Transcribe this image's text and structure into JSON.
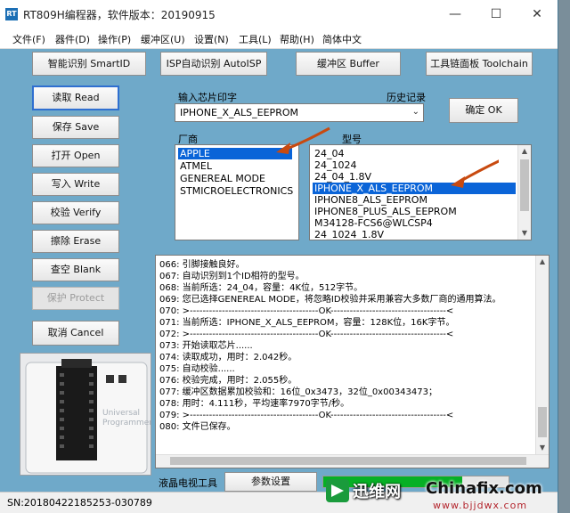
{
  "window": {
    "title": "RT809H编程器，软件版本：20190915"
  },
  "menu": [
    {
      "label": "文件(F)"
    },
    {
      "label": "器件(D)"
    },
    {
      "label": "操作(P)"
    },
    {
      "label": "缓冲区(U)"
    },
    {
      "label": "设置(N)"
    },
    {
      "label": "工具(L)"
    },
    {
      "label": "帮助(H)"
    },
    {
      "label": "简体中文"
    }
  ],
  "toolbar": {
    "smart_id": "智能识别 SmartID",
    "isp_auto": "ISP自动识别 AutoISP",
    "buffer": "缓冲区 Buffer",
    "toolchain": "工具链面板 Toolchain"
  },
  "actions": {
    "read": "读取 Read",
    "save": "保存 Save",
    "open": "打开 Open",
    "write": "写入 Write",
    "verify": "校验 Verify",
    "erase": "擦除 Erase",
    "blank": "查空 Blank",
    "protect": "保护 Protect",
    "cancel": "取消 Cancel"
  },
  "chip_input": {
    "label": "输入芯片印字",
    "history_label": "历史记录",
    "value": "IPHONE_X_ALS_EEPROM",
    "confirm": "确定 OK"
  },
  "vendor": {
    "label": "厂商",
    "items": [
      {
        "label": "APPLE",
        "selected": true
      },
      {
        "label": "ATMEL",
        "selected": false
      },
      {
        "label": "GENEREAL MODE",
        "selected": false
      },
      {
        "label": "STMICROELECTRONICS",
        "selected": false
      }
    ]
  },
  "model": {
    "label": "型号",
    "items": [
      {
        "label": "24_04",
        "selected": false
      },
      {
        "label": "24_1024",
        "selected": false
      },
      {
        "label": "24_04_1.8V",
        "selected": false
      },
      {
        "label": "IPHONE_X_ALS_EEPROM",
        "selected": true
      },
      {
        "label": "IPHONE8_ALS_EEPROM",
        "selected": false
      },
      {
        "label": "IPHONE8_PLUS_ALS_EEPROM",
        "selected": false
      },
      {
        "label": "M34128-FCS6@WLCSP4",
        "selected": false
      },
      {
        "label": "24_1024_1.8V",
        "selected": false
      }
    ]
  },
  "log": [
    "066:  引脚接触良好。",
    "067:  自动识别到1个ID相符的型号。",
    "068:  当前所选：24_04，容量：4K位，512字节。",
    "069:  您已选择GENEREAL MODE，将忽略ID校验并采用兼容大多数厂商的通用算法。",
    "070:  >----------------------------------------OK------------------------------------<",
    "071:  当前所选：IPHONE_X_ALS_EEPROM，容量：128K位，16K字节。",
    "072:  >----------------------------------------OK------------------------------------<",
    "073:  开始读取芯片......",
    "074:  读取成功，用时：2.042秒。",
    "075:  自动校验......",
    "076:  校验完成，用时：2.055秒。",
    "077:  缓冲区数据累加校验和：16位_0x3473，32位_0x00343473；",
    "078:  用时：4.111秒，平均速率7970字节/秒。",
    "079:  >----------------------------------------OK------------------------------------<",
    "080:  文件已保存。"
  ],
  "bottom": {
    "tv_tools": "液晶电视工具",
    "params": "参数设置",
    "progress_fraction": 0.75
  },
  "status": {
    "sn": "SN:20180422185253-030789"
  },
  "device_image": {
    "brand": "Universal Programmer"
  },
  "watermark": {
    "brand_cn": "迅维网",
    "site": "Chinafix.com",
    "url": "www.bjjdwx.com"
  },
  "colors": {
    "panel_bg": "#6fa9c9",
    "selection": "#0a64d8",
    "progress": "#06b025",
    "arrow": "#c84a10"
  }
}
